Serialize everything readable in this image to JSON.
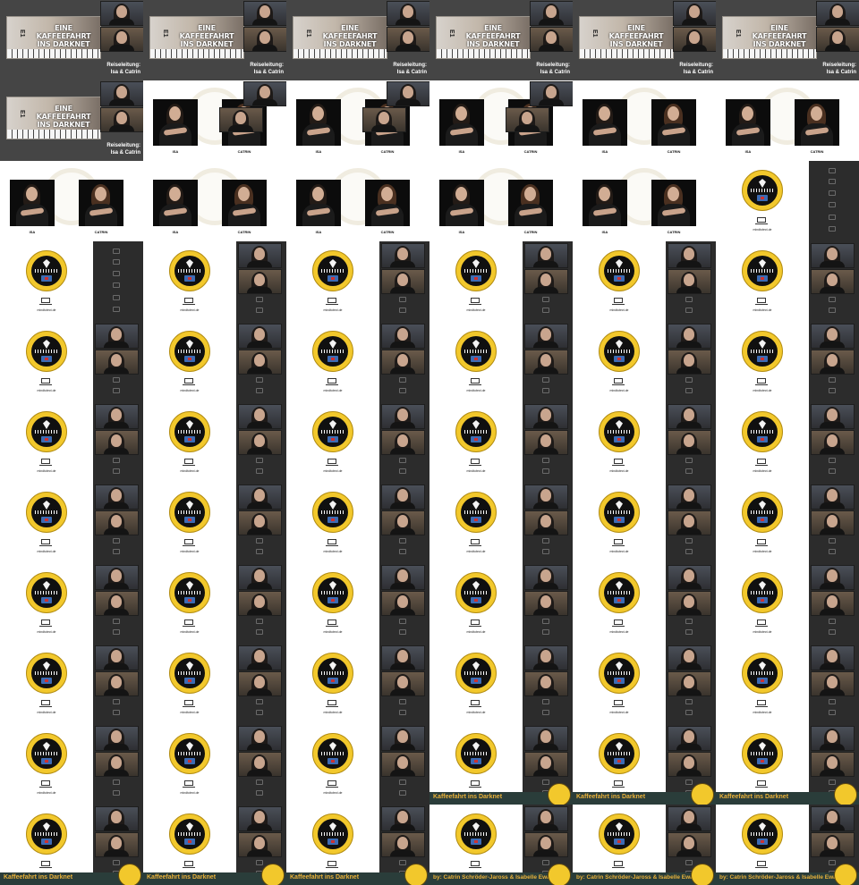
{
  "grid": {
    "columns": 6,
    "rows": 11,
    "cell_width": 160,
    "cell_height": 90
  },
  "title_slide": {
    "title": "EINE KAFFEEFAHRT INS DARKNET",
    "episode_mark": "E1",
    "credits_label": "Reiseleitung:",
    "credits_names": "Isa & Catrin"
  },
  "host_slide": {
    "host_left": "ISA",
    "host_right": "CATRIN"
  },
  "cover": {
    "url_text": "mindtotect.de"
  },
  "brand_bar": {
    "show_title": "Kaffeefahrt ins Darknet",
    "authors": "by: Catrin Schröder-Jaross & Isabelle Ewald"
  },
  "cells": [
    {
      "type": "title"
    },
    {
      "type": "title"
    },
    {
      "type": "title"
    },
    {
      "type": "title"
    },
    {
      "type": "title"
    },
    {
      "type": "title"
    },
    {
      "type": "title"
    },
    {
      "type": "host_cam"
    },
    {
      "type": "host_cam"
    },
    {
      "type": "host_cam"
    },
    {
      "type": "host"
    },
    {
      "type": "host"
    },
    {
      "type": "host"
    },
    {
      "type": "host"
    },
    {
      "type": "host"
    },
    {
      "type": "host"
    },
    {
      "type": "host"
    },
    {
      "type": "cover_tools"
    },
    {
      "type": "cover_tools"
    },
    {
      "type": "cover"
    },
    {
      "type": "cover"
    },
    {
      "type": "cover"
    },
    {
      "type": "cover"
    },
    {
      "type": "cover"
    },
    {
      "type": "cover"
    },
    {
      "type": "cover"
    },
    {
      "type": "cover"
    },
    {
      "type": "cover"
    },
    {
      "type": "cover"
    },
    {
      "type": "cover"
    },
    {
      "type": "cover"
    },
    {
      "type": "cover"
    },
    {
      "type": "cover"
    },
    {
      "type": "cover"
    },
    {
      "type": "cover"
    },
    {
      "type": "cover"
    },
    {
      "type": "cover"
    },
    {
      "type": "cover"
    },
    {
      "type": "cover"
    },
    {
      "type": "cover"
    },
    {
      "type": "cover"
    },
    {
      "type": "cover"
    },
    {
      "type": "cover"
    },
    {
      "type": "cover"
    },
    {
      "type": "cover"
    },
    {
      "type": "cover"
    },
    {
      "type": "cover"
    },
    {
      "type": "cover"
    },
    {
      "type": "cover"
    },
    {
      "type": "cover"
    },
    {
      "type": "cover"
    },
    {
      "type": "cover"
    },
    {
      "type": "cover"
    },
    {
      "type": "cover"
    },
    {
      "type": "cover"
    },
    {
      "type": "cover"
    },
    {
      "type": "cover"
    },
    {
      "type": "cover_brand_title"
    },
    {
      "type": "cover_brand_title"
    },
    {
      "type": "cover_brand_title"
    },
    {
      "type": "cover_brand_title"
    },
    {
      "type": "cover_brand_title"
    },
    {
      "type": "cover_brand_title"
    },
    {
      "type": "cover_brand_authors"
    },
    {
      "type": "cover_brand_authors"
    },
    {
      "type": "cover_brand_authors"
    }
  ]
}
